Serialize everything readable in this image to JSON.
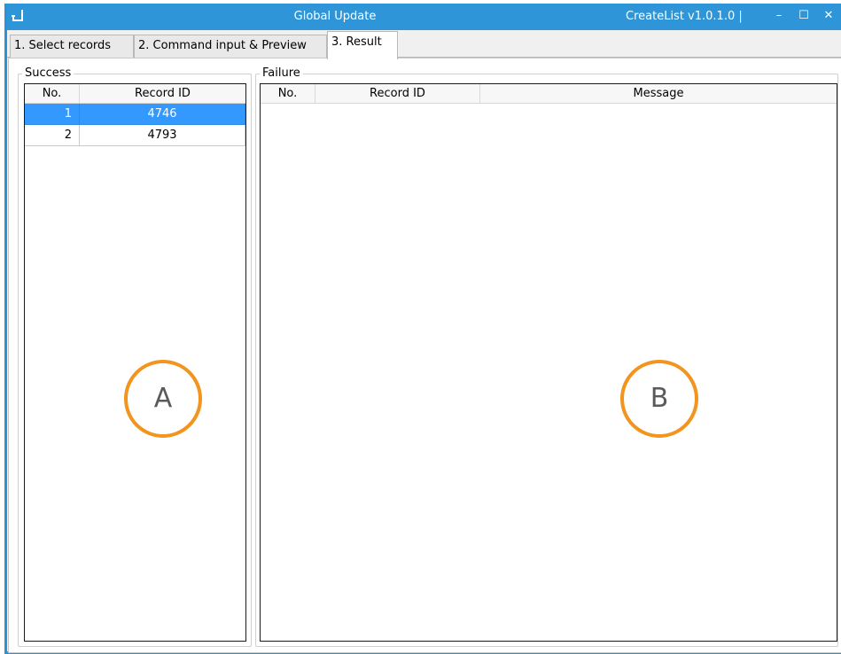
{
  "window": {
    "title": "Global Update",
    "version": "CreateList v1.0.1.0 |",
    "controls": {
      "minimize": "–",
      "maximize": "☐",
      "close": "✕"
    },
    "accent": "#2d95d8"
  },
  "tabs": [
    {
      "label": "1. Select records",
      "active": false
    },
    {
      "label": "2. Command input & Preview",
      "active": false
    },
    {
      "label": "3. Result",
      "active": true
    }
  ],
  "success": {
    "legend": "Success",
    "columns": [
      "No.",
      "Record ID"
    ],
    "rows": [
      {
        "no": "1",
        "record_id": "4746",
        "selected": true
      },
      {
        "no": "2",
        "record_id": "4793",
        "selected": false
      }
    ]
  },
  "failure": {
    "legend": "Failure",
    "columns": [
      "No.",
      "Record ID",
      "Message"
    ],
    "rows": []
  },
  "markers": {
    "a": "A",
    "b": "B",
    "color": "#f2941d"
  }
}
